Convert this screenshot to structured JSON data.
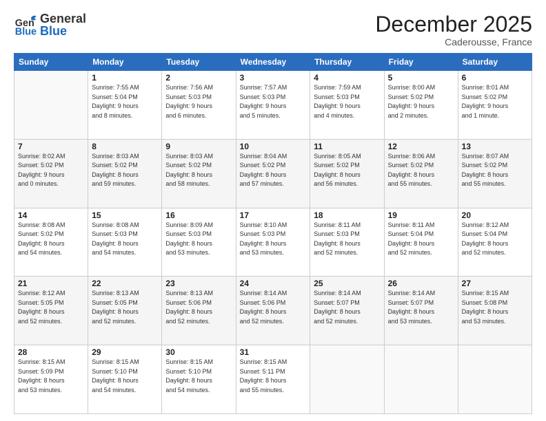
{
  "header": {
    "logo_general": "General",
    "logo_blue": "Blue",
    "title": "December 2025",
    "location": "Caderousse, France"
  },
  "weekdays": [
    "Sunday",
    "Monday",
    "Tuesday",
    "Wednesday",
    "Thursday",
    "Friday",
    "Saturday"
  ],
  "weeks": [
    [
      {
        "day": "",
        "info": ""
      },
      {
        "day": "1",
        "info": "Sunrise: 7:55 AM\nSunset: 5:04 PM\nDaylight: 9 hours\nand 8 minutes."
      },
      {
        "day": "2",
        "info": "Sunrise: 7:56 AM\nSunset: 5:03 PM\nDaylight: 9 hours\nand 6 minutes."
      },
      {
        "day": "3",
        "info": "Sunrise: 7:57 AM\nSunset: 5:03 PM\nDaylight: 9 hours\nand 5 minutes."
      },
      {
        "day": "4",
        "info": "Sunrise: 7:59 AM\nSunset: 5:03 PM\nDaylight: 9 hours\nand 4 minutes."
      },
      {
        "day": "5",
        "info": "Sunrise: 8:00 AM\nSunset: 5:02 PM\nDaylight: 9 hours\nand 2 minutes."
      },
      {
        "day": "6",
        "info": "Sunrise: 8:01 AM\nSunset: 5:02 PM\nDaylight: 9 hours\nand 1 minute."
      }
    ],
    [
      {
        "day": "7",
        "info": "Sunrise: 8:02 AM\nSunset: 5:02 PM\nDaylight: 9 hours\nand 0 minutes."
      },
      {
        "day": "8",
        "info": "Sunrise: 8:03 AM\nSunset: 5:02 PM\nDaylight: 8 hours\nand 59 minutes."
      },
      {
        "day": "9",
        "info": "Sunrise: 8:03 AM\nSunset: 5:02 PM\nDaylight: 8 hours\nand 58 minutes."
      },
      {
        "day": "10",
        "info": "Sunrise: 8:04 AM\nSunset: 5:02 PM\nDaylight: 8 hours\nand 57 minutes."
      },
      {
        "day": "11",
        "info": "Sunrise: 8:05 AM\nSunset: 5:02 PM\nDaylight: 8 hours\nand 56 minutes."
      },
      {
        "day": "12",
        "info": "Sunrise: 8:06 AM\nSunset: 5:02 PM\nDaylight: 8 hours\nand 55 minutes."
      },
      {
        "day": "13",
        "info": "Sunrise: 8:07 AM\nSunset: 5:02 PM\nDaylight: 8 hours\nand 55 minutes."
      }
    ],
    [
      {
        "day": "14",
        "info": "Sunrise: 8:08 AM\nSunset: 5:02 PM\nDaylight: 8 hours\nand 54 minutes."
      },
      {
        "day": "15",
        "info": "Sunrise: 8:08 AM\nSunset: 5:03 PM\nDaylight: 8 hours\nand 54 minutes."
      },
      {
        "day": "16",
        "info": "Sunrise: 8:09 AM\nSunset: 5:03 PM\nDaylight: 8 hours\nand 53 minutes."
      },
      {
        "day": "17",
        "info": "Sunrise: 8:10 AM\nSunset: 5:03 PM\nDaylight: 8 hours\nand 53 minutes."
      },
      {
        "day": "18",
        "info": "Sunrise: 8:11 AM\nSunset: 5:03 PM\nDaylight: 8 hours\nand 52 minutes."
      },
      {
        "day": "19",
        "info": "Sunrise: 8:11 AM\nSunset: 5:04 PM\nDaylight: 8 hours\nand 52 minutes."
      },
      {
        "day": "20",
        "info": "Sunrise: 8:12 AM\nSunset: 5:04 PM\nDaylight: 8 hours\nand 52 minutes."
      }
    ],
    [
      {
        "day": "21",
        "info": "Sunrise: 8:12 AM\nSunset: 5:05 PM\nDaylight: 8 hours\nand 52 minutes."
      },
      {
        "day": "22",
        "info": "Sunrise: 8:13 AM\nSunset: 5:05 PM\nDaylight: 8 hours\nand 52 minutes."
      },
      {
        "day": "23",
        "info": "Sunrise: 8:13 AM\nSunset: 5:06 PM\nDaylight: 8 hours\nand 52 minutes."
      },
      {
        "day": "24",
        "info": "Sunrise: 8:14 AM\nSunset: 5:06 PM\nDaylight: 8 hours\nand 52 minutes."
      },
      {
        "day": "25",
        "info": "Sunrise: 8:14 AM\nSunset: 5:07 PM\nDaylight: 8 hours\nand 52 minutes."
      },
      {
        "day": "26",
        "info": "Sunrise: 8:14 AM\nSunset: 5:07 PM\nDaylight: 8 hours\nand 53 minutes."
      },
      {
        "day": "27",
        "info": "Sunrise: 8:15 AM\nSunset: 5:08 PM\nDaylight: 8 hours\nand 53 minutes."
      }
    ],
    [
      {
        "day": "28",
        "info": "Sunrise: 8:15 AM\nSunset: 5:09 PM\nDaylight: 8 hours\nand 53 minutes."
      },
      {
        "day": "29",
        "info": "Sunrise: 8:15 AM\nSunset: 5:10 PM\nDaylight: 8 hours\nand 54 minutes."
      },
      {
        "day": "30",
        "info": "Sunrise: 8:15 AM\nSunset: 5:10 PM\nDaylight: 8 hours\nand 54 minutes."
      },
      {
        "day": "31",
        "info": "Sunrise: 8:15 AM\nSunset: 5:11 PM\nDaylight: 8 hours\nand 55 minutes."
      },
      {
        "day": "",
        "info": ""
      },
      {
        "day": "",
        "info": ""
      },
      {
        "day": "",
        "info": ""
      }
    ]
  ]
}
